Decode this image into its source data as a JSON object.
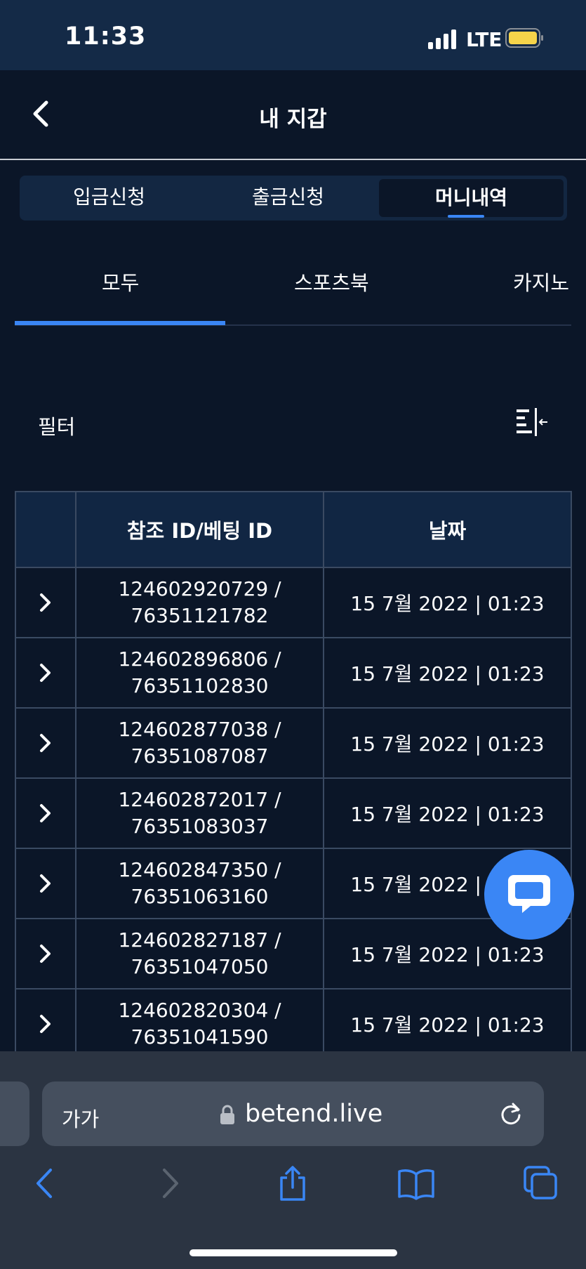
{
  "status_bar": {
    "time": "11:33",
    "network": "LTE"
  },
  "header": {
    "title": "내 지갑"
  },
  "segments": [
    {
      "label": "입금신청",
      "active": false
    },
    {
      "label": "출금신청",
      "active": false
    },
    {
      "label": "머니내역",
      "active": true
    }
  ],
  "sub_tabs": [
    {
      "label": "모두",
      "active": true
    },
    {
      "label": "스포츠북",
      "active": false
    },
    {
      "label": "카지노",
      "active": false
    }
  ],
  "filter": {
    "label": "필터"
  },
  "table": {
    "headers": [
      "",
      "참조 ID/베팅 ID",
      "날짜"
    ],
    "rows": [
      {
        "ref_id": "124602920729 /",
        "bet_id": "76351121782",
        "date": "15 7월 2022 | 01:23"
      },
      {
        "ref_id": "124602896806 /",
        "bet_id": "76351102830",
        "date": "15 7월 2022 | 01:23"
      },
      {
        "ref_id": "124602877038 /",
        "bet_id": "76351087087",
        "date": "15 7월 2022 | 01:23"
      },
      {
        "ref_id": "124602872017 /",
        "bet_id": "76351083037",
        "date": "15 7월 2022 | 01:23"
      },
      {
        "ref_id": "124602847350 /",
        "bet_id": "76351063160",
        "date": "15 7월 2022 | 01:23"
      },
      {
        "ref_id": "124602827187 /",
        "bet_id": "76351047050",
        "date": "15 7월 2022 | 01:23"
      },
      {
        "ref_id": "124602820304 /",
        "bet_id": "76351041590",
        "date": "15 7월 2022 | 01:23"
      }
    ]
  },
  "browser": {
    "text_size": "가가",
    "url": "betend.live"
  },
  "colors": {
    "background": "#0b1628",
    "status_bar": "#142a47",
    "accent": "#3a86f5",
    "table_header": "#112643",
    "browser_bar": "#2b3442",
    "browser_nav_icon": "#3a86f5"
  }
}
